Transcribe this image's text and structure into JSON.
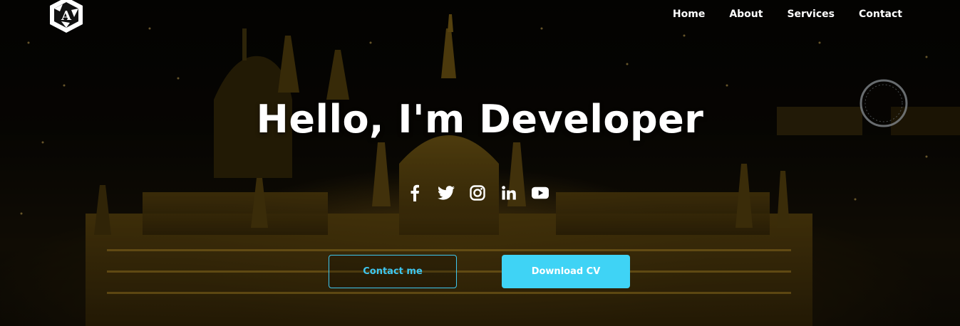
{
  "nav": {
    "items": [
      {
        "label": "Home"
      },
      {
        "label": "About"
      },
      {
        "label": "Services"
      },
      {
        "label": "Contact"
      }
    ]
  },
  "logo": {
    "letter": "A",
    "icon": "hexagon-logo-icon"
  },
  "hero": {
    "title": "Hello, I'm Developer",
    "social": [
      {
        "icon": "facebook-icon"
      },
      {
        "icon": "twitter-icon"
      },
      {
        "icon": "instagram-icon"
      },
      {
        "icon": "linkedin-icon"
      },
      {
        "icon": "youtube-icon"
      }
    ],
    "contact_button": "Contact me",
    "download_button": "Download CV"
  },
  "colors": {
    "accent": "#3fd3f5",
    "accent_outline": "#3ec7f0",
    "text": "#ffffff"
  }
}
